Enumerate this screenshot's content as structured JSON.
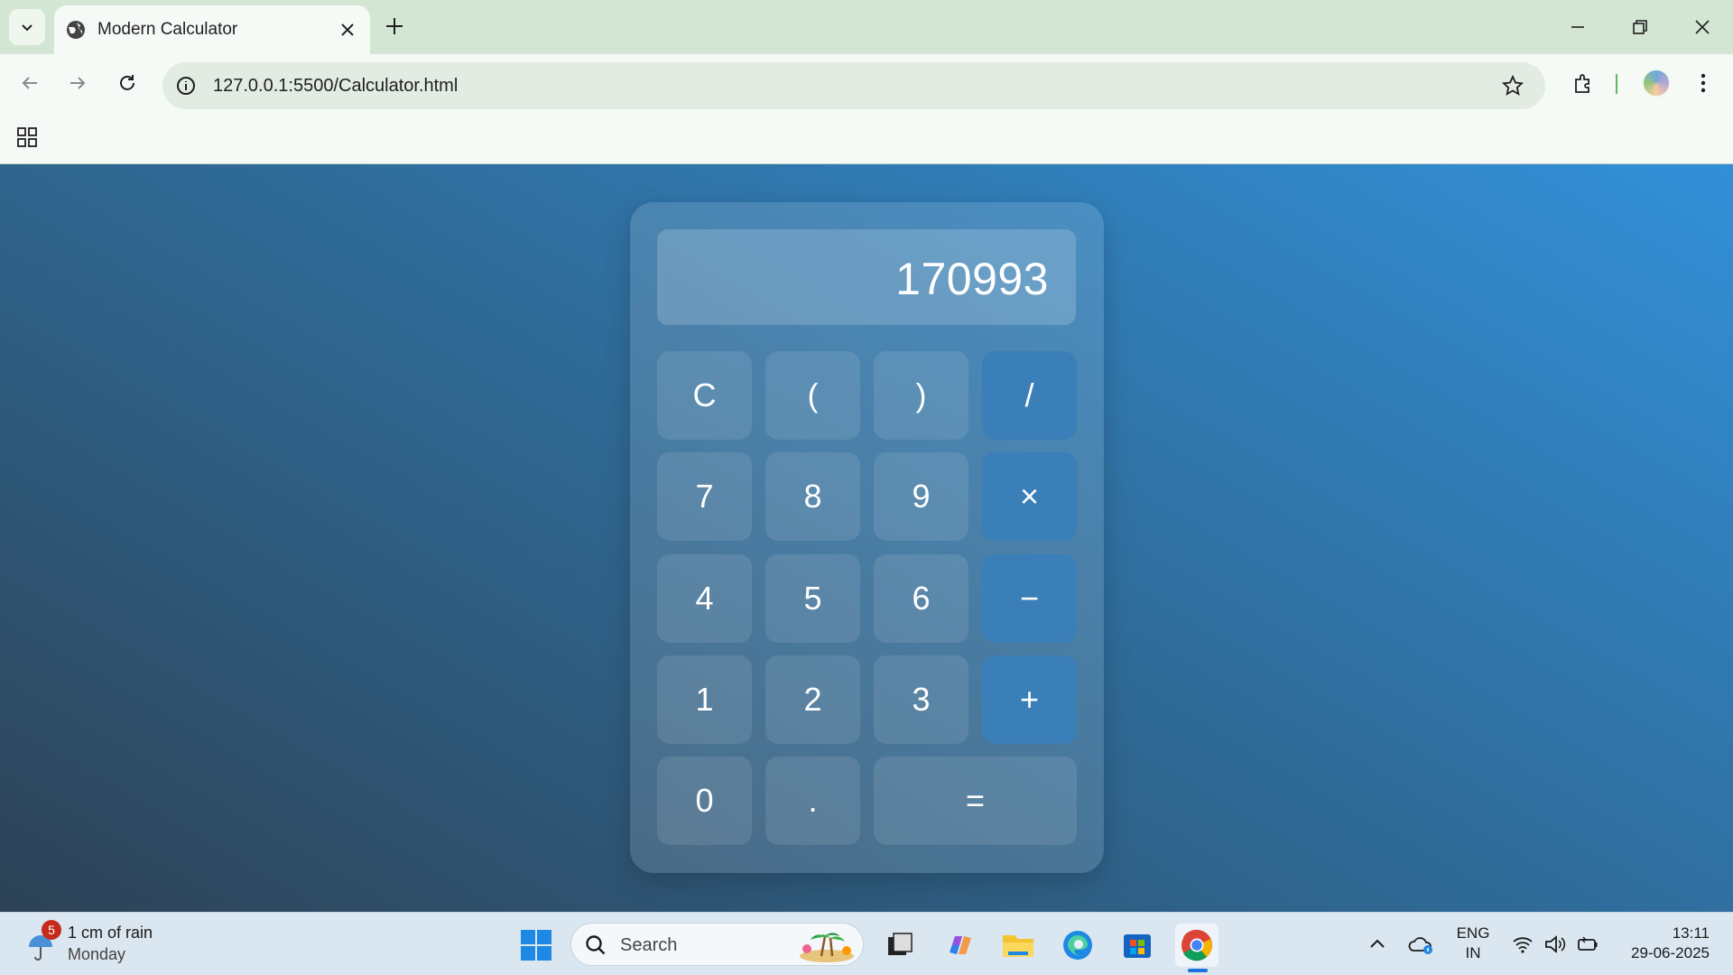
{
  "browser": {
    "tab_title": "Modern Calculator",
    "url": "127.0.0.1:5500/Calculator.html"
  },
  "calculator": {
    "display": "170993",
    "keys": {
      "clear": "C",
      "paren_open": "(",
      "paren_close": ")",
      "divide": "/",
      "seven": "7",
      "eight": "8",
      "nine": "9",
      "multiply": "×",
      "four": "4",
      "five": "5",
      "six": "6",
      "subtract": "−",
      "one": "1",
      "two": "2",
      "three": "3",
      "add": "+",
      "zero": "0",
      "decimal": ".",
      "equals": "="
    },
    "colors": {
      "operator_key": "#3a7fb8",
      "background_start": "#2d4256",
      "background_end": "#3290d8"
    }
  },
  "taskbar": {
    "weather": {
      "text": "1 cm of rain",
      "day": "Monday",
      "badge": "5"
    },
    "search_placeholder": "Search",
    "language": {
      "line1": "ENG",
      "line2": "IN"
    },
    "time": "13:11",
    "date": "29-06-2025"
  }
}
